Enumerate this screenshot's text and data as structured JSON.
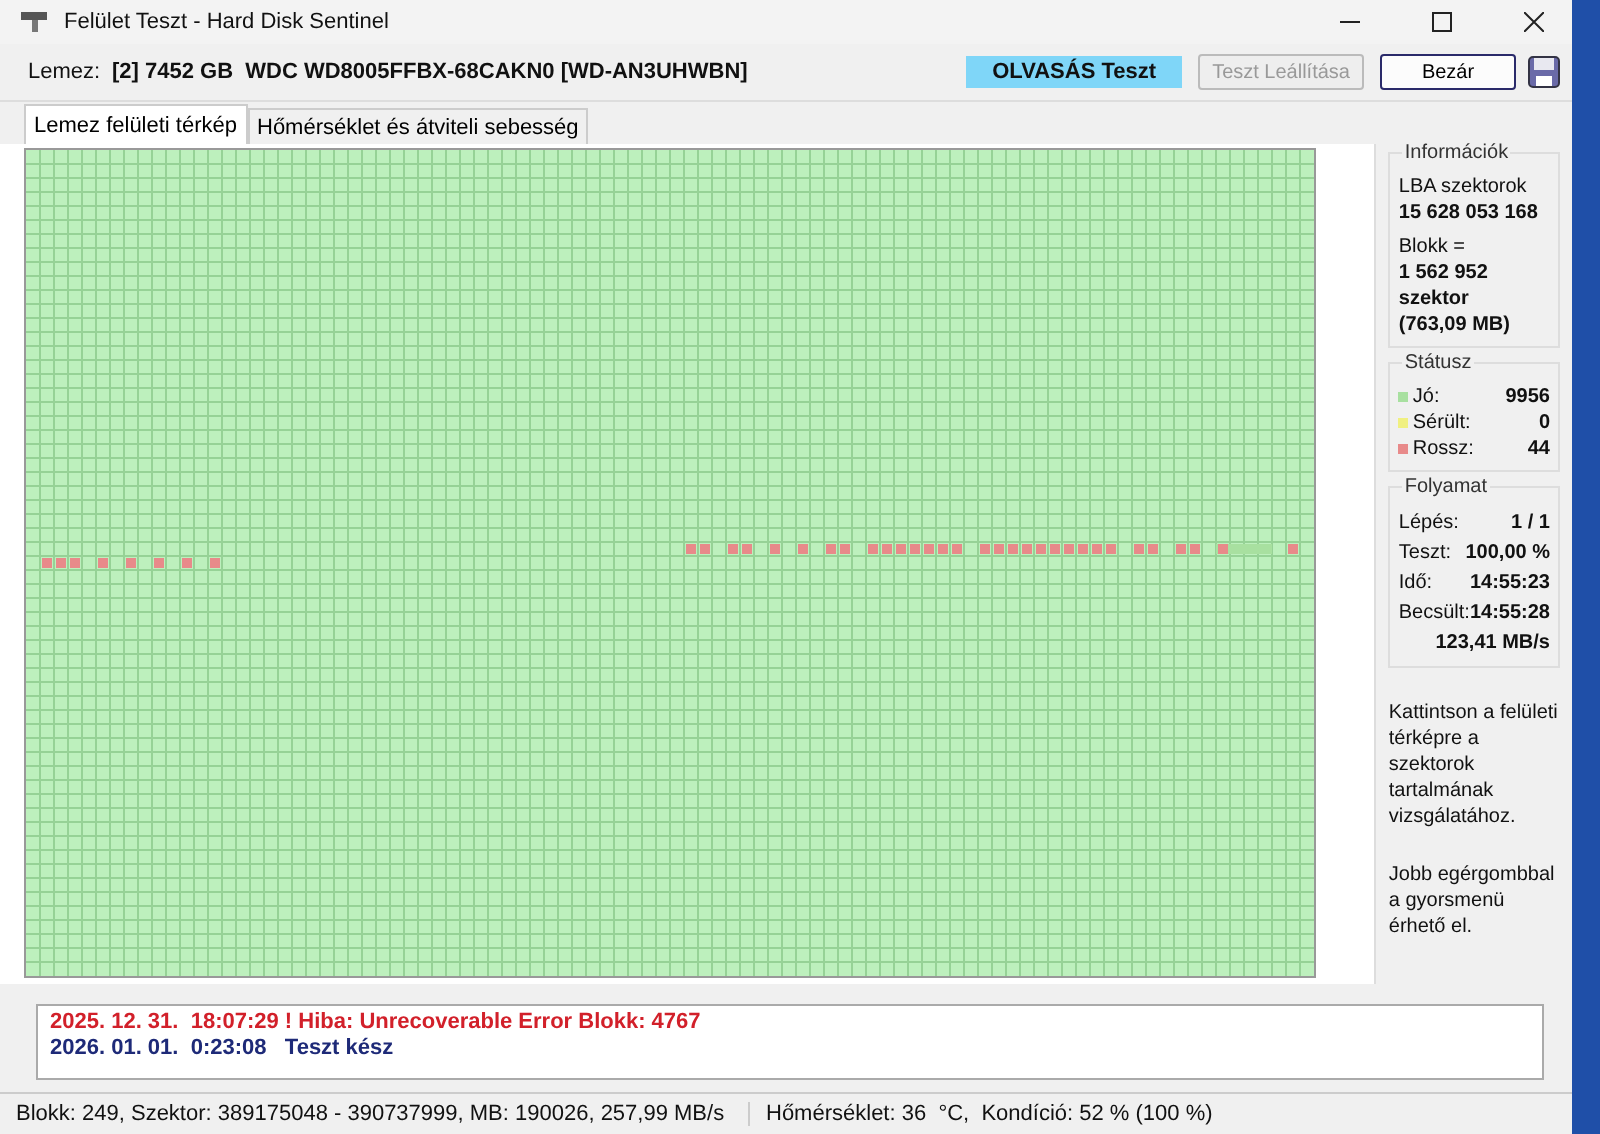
{
  "window": {
    "title": "Felület Teszt - Hard Disk Sentinel"
  },
  "toolbar": {
    "disk_label": "Lemez:",
    "disk": "[2] 7452 GB  WDC WD8005FFBX-68CAKN0 [WD-AN3UHWBN]",
    "status": "OLVASÁS Teszt",
    "buttons": [
      {
        "label": "Teszt Leállítása",
        "disabled": true
      },
      {
        "label": "Bezár",
        "disabled": false
      }
    ]
  },
  "tabs": [
    {
      "label": "Lemez felületi térkép",
      "selected": true
    },
    {
      "label": "Hőmérséklet és átviteli sebesség",
      "selected": false
    }
  ],
  "info": {
    "title": "Információk",
    "lines": [
      {
        "text": "LBA szektorok",
        "bold": false
      },
      {
        "text": "15 628 053 168",
        "bold": true
      },
      {
        "text": "Blokk =",
        "bold": false
      },
      {
        "text": "1 562 952 szektor",
        "bold": true
      },
      {
        "text": "(763,09 MB)",
        "bold": true
      }
    ]
  },
  "status": {
    "title": "Státusz",
    "items": [
      {
        "label": "Jó:",
        "value": "9956",
        "color": "#a8e0a0"
      },
      {
        "label": "Sérült:",
        "value": "0",
        "color": "#f0f080"
      },
      {
        "label": "Rossz:",
        "value": "44",
        "color": "#e88a8a"
      }
    ]
  },
  "progress": {
    "title": "Folyamat",
    "items": [
      {
        "label": "Lépés:",
        "value": "1 / 1"
      },
      {
        "label": "Teszt:",
        "value": "100,00 %"
      },
      {
        "label": "Idő:",
        "value": "14:55:23"
      },
      {
        "label": "Becsült:",
        "value": "14:55:28"
      }
    ],
    "speed": "123,41 MB/s"
  },
  "hints": [
    "Kattintson a felületi térképre a szektorok tartalmának vizsgálatához.",
    "Jobb egérgombbal a gyorsmenü érhető el."
  ],
  "log": [
    {
      "kind": "error",
      "text": "2025. 12. 31.  18:07:29 ! Hiba: Unrecoverable Error Blokk: 4767"
    },
    {
      "kind": "info",
      "text": "2026. 01. 01.  0:23:08   Teszt kész"
    }
  ],
  "status_bar": [
    "Blokk: 249, Szektor: 389175048 - 390737999, MB: 190026, 257,99 MB/s",
    "Hőmérséklet: 36  °C,  Kondíció: 52 % (100 %)"
  ]
}
